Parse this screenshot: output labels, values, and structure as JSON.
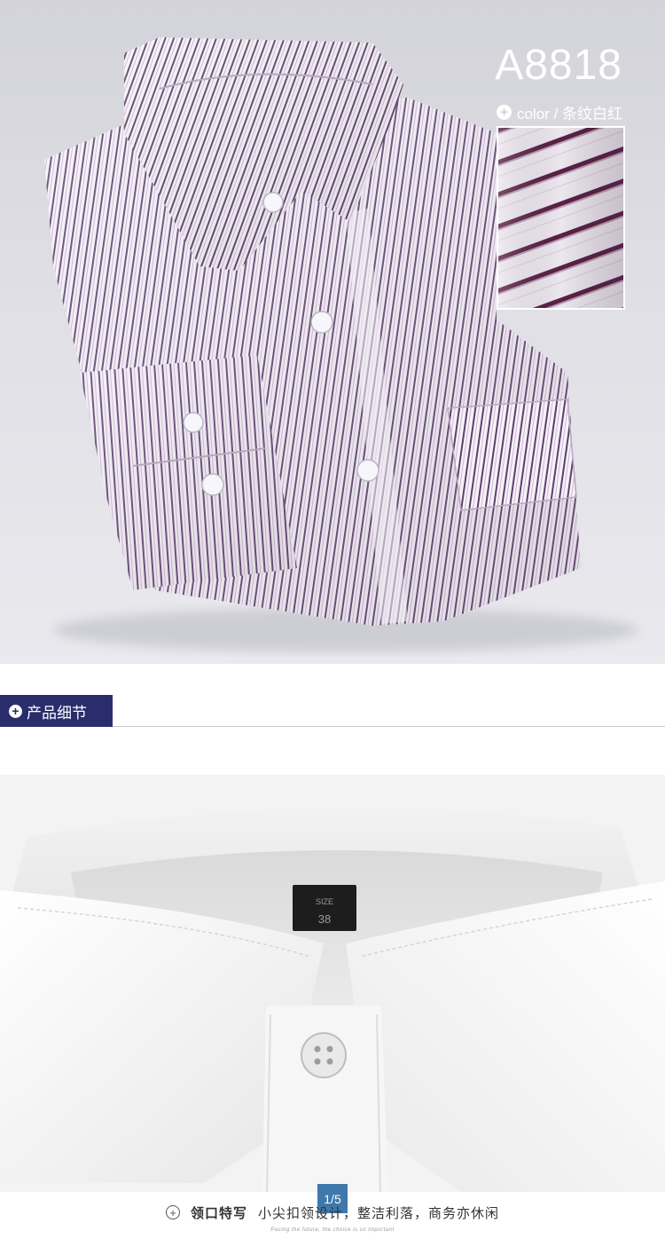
{
  "hero": {
    "model_code": "A8818",
    "color_label": "color / 条纹白红",
    "plus_glyph": "+"
  },
  "section": {
    "title": "产品细节",
    "plus_glyph": "+"
  },
  "detail": {
    "label_text": "38",
    "pager": "1/5",
    "caption_title": "领口特写",
    "caption_text": "小尖扣领设计，整洁利落，商务亦休闲",
    "slogan": "Pacing the future, the choice is so important"
  },
  "colors": {
    "stripe": "#6d4a7a",
    "nav": "#2a2d6c",
    "pager": "#3f79ab"
  }
}
